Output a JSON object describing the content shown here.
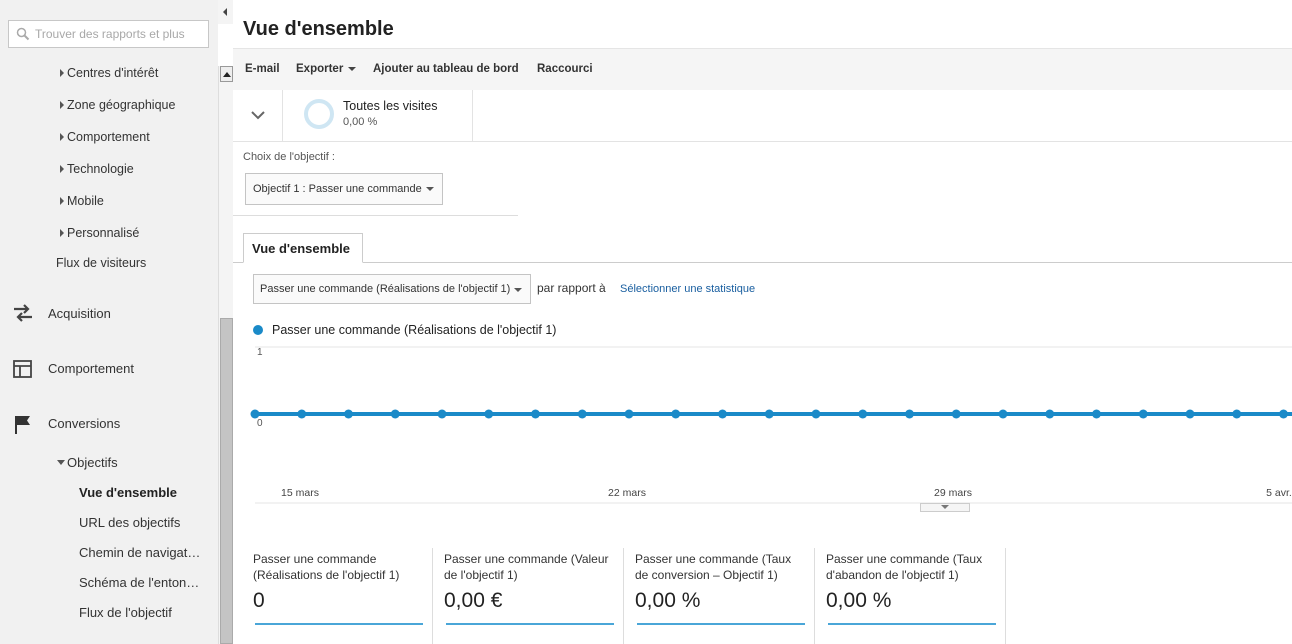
{
  "search": {
    "placeholder": "Trouver des rapports et plus"
  },
  "sidebar": {
    "audience_items": [
      "Centres d'intérêt",
      "Zone géographique",
      "Comportement",
      "Technologie",
      "Mobile",
      "Personnalisé"
    ],
    "visitor_flow": "Flux de visiteurs",
    "sections": [
      {
        "label": "Acquisition",
        "icon": "acquisition-arrows-icon"
      },
      {
        "label": "Comportement",
        "icon": "behavior-layout-icon"
      },
      {
        "label": "Conversions",
        "icon": "flag-icon"
      }
    ],
    "objectifs": "Objectifs",
    "objectif_items": [
      "Vue d'ensemble",
      "URL des objectifs",
      "Chemin de navigat…",
      "Schéma de l'enton…",
      "Flux de l'objectif"
    ]
  },
  "page": {
    "title": "Vue d'ensemble"
  },
  "toolbar": {
    "email": "E-mail",
    "export": "Exporter",
    "dashboard": "Ajouter au tableau de bord",
    "shortcut": "Raccourci"
  },
  "segment": {
    "name": "Toutes les visites",
    "percent": "0,00 %",
    "ring_fill": 0
  },
  "goal_choice": {
    "label": "Choix de l'objectif :",
    "selected": "Objectif 1 : Passer une commande"
  },
  "tab": {
    "label": "Vue d'ensemble"
  },
  "metric_select": {
    "selected": "Passer une commande (Réalisations de l'objectif 1)",
    "compare_text": "par rapport à",
    "select_link": "Sélectionner une statistique"
  },
  "colors": {
    "series": "#1a8ac8",
    "link": "#1a5fa0",
    "accent": "#4aa6d8"
  },
  "chart_data": {
    "type": "line",
    "series": [
      {
        "name": "Passer une commande (Réalisations de l'objectif 1)",
        "values": [
          0,
          0,
          0,
          0,
          0,
          0,
          0,
          0,
          0,
          0,
          0,
          0,
          0,
          0,
          0,
          0,
          0,
          0,
          0,
          0,
          0,
          0,
          0,
          0,
          0
        ]
      }
    ],
    "x_tick_labels": [
      "15 mars",
      "22 mars",
      "29 mars",
      "5 avr."
    ],
    "y_tick_labels": [
      "1",
      "0"
    ],
    "ylim": [
      0,
      1
    ],
    "grid": true
  },
  "scorecards": [
    {
      "label_line1": "Passer une commande",
      "label_line2": "(Réalisations de l'objectif 1)",
      "value": "0"
    },
    {
      "label_line1": "Passer une commande (Valeur",
      "label_line2": "de l'objectif 1)",
      "value": "0,00 €"
    },
    {
      "label_line1": "Passer une commande (Taux",
      "label_line2": "de conversion – Objectif 1)",
      "value": "0,00 %"
    },
    {
      "label_line1": "Passer une commande (Taux",
      "label_line2": "d'abandon de l'objectif 1)",
      "value": "0,00 %"
    }
  ]
}
